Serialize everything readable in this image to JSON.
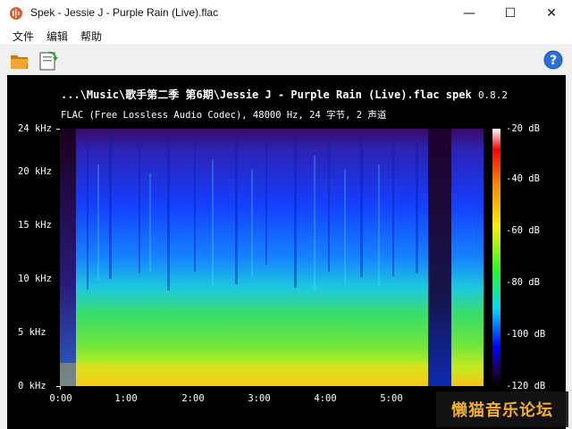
{
  "window": {
    "title": "Spek - Jessie J - Purple Rain (Live).flac",
    "controls": {
      "minimize": "—",
      "maximize": "☐",
      "close": "✕"
    }
  },
  "menu": {
    "items": [
      "文件",
      "编辑",
      "帮助"
    ]
  },
  "toolbar": {
    "open_icon": "folder-open-icon",
    "save_icon": "save-image-icon",
    "help_icon": "help-icon"
  },
  "spectrum": {
    "file_path": "...\\Music\\歌手第二季 第6期\\Jessie J - Purple Rain (Live).flac",
    "app_name": "spek",
    "version": "0.8.2",
    "info": "FLAC (Free Lossless Audio Codec), 48000 Hz, 24 字节, 2 声道",
    "y_ticks": [
      "24 kHz",
      "20 kHz",
      "15 kHz",
      "10 kHz",
      "5 kHz",
      "0 kHz"
    ],
    "x_ticks": [
      "0:00",
      "1:00",
      "2:00",
      "3:00",
      "4:00",
      "5:00"
    ],
    "db_ticks": [
      "-20 dB",
      "-40 dB",
      "-60 dB",
      "-80 dB",
      "-100 dB",
      "-120 dB"
    ]
  },
  "watermark": {
    "text": "懒猫音乐论坛"
  }
}
